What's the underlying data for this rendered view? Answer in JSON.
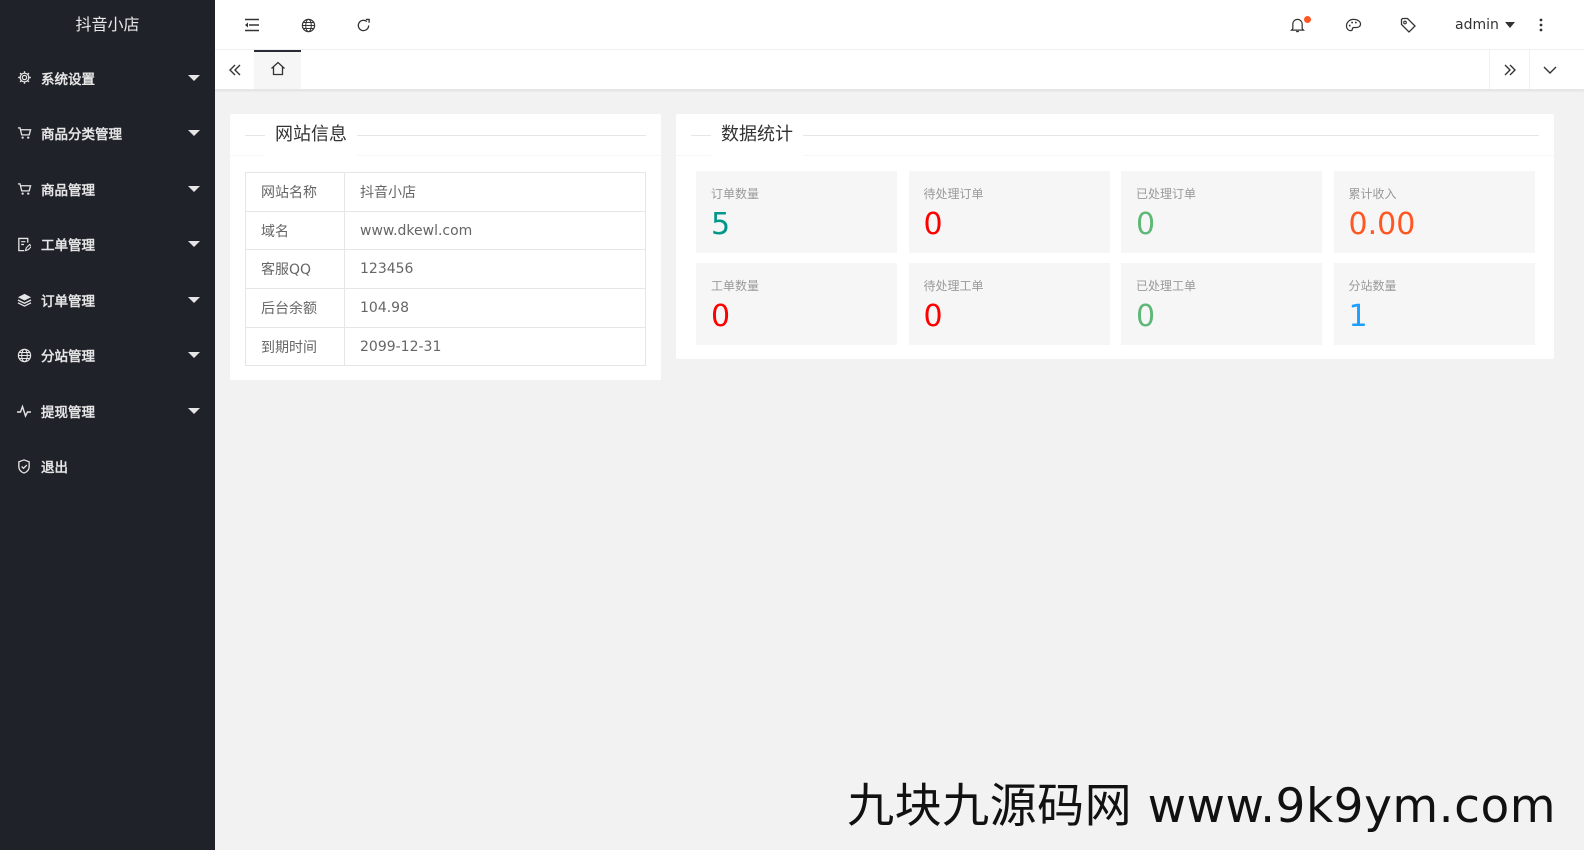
{
  "app": {
    "title": "抖音小店"
  },
  "sidebar": {
    "items": [
      {
        "label": "系统设置",
        "icon": "gear-icon",
        "expandable": true
      },
      {
        "label": "商品分类管理",
        "icon": "cart-icon",
        "expandable": true
      },
      {
        "label": "商品管理",
        "icon": "cart-icon",
        "expandable": true
      },
      {
        "label": "工单管理",
        "icon": "edit-doc-icon",
        "expandable": true
      },
      {
        "label": "订单管理",
        "icon": "layers-icon",
        "expandable": true
      },
      {
        "label": "分站管理",
        "icon": "globe-icon",
        "expandable": true
      },
      {
        "label": "提现管理",
        "icon": "pulse-icon",
        "expandable": true
      },
      {
        "label": "退出",
        "icon": "shield-icon",
        "expandable": false
      }
    ]
  },
  "header": {
    "user": "admin",
    "icons": [
      "menu-fold-icon",
      "globe-icon",
      "refresh-icon",
      "bell-icon",
      "theme-icon",
      "tag-icon",
      "more-icon"
    ],
    "notification_color": "#ff5722"
  },
  "tabs": {
    "home_icon": "home-icon"
  },
  "site_info": {
    "title": "网站信息",
    "rows": [
      {
        "key": "网站名称",
        "value": "抖音小店"
      },
      {
        "key": "域名",
        "value": "www.dkewl.com"
      },
      {
        "key": "客服QQ",
        "value": "123456"
      },
      {
        "key": "后台余额",
        "value": "104.98"
      },
      {
        "key": "到期时间",
        "value": "2099-12-31"
      }
    ]
  },
  "stats": {
    "title": "数据统计",
    "items": [
      {
        "label": "订单数量",
        "value": "5",
        "color": "#009688"
      },
      {
        "label": "待处理订单",
        "value": "0",
        "color": "#ff0000"
      },
      {
        "label": "已处理订单",
        "value": "0",
        "color": "#5fb878"
      },
      {
        "label": "累计收入",
        "value": "0.00",
        "color": "#ff5722"
      },
      {
        "label": "工单数量",
        "value": "0",
        "color": "#ff0000"
      },
      {
        "label": "待处理工单",
        "value": "0",
        "color": "#ff0000"
      },
      {
        "label": "已处理工单",
        "value": "0",
        "color": "#5fb878"
      },
      {
        "label": "分站数量",
        "value": "1",
        "color": "#1e9fff"
      }
    ]
  },
  "watermark": {
    "text": "九块九源码网 www.9k9ym.com"
  }
}
